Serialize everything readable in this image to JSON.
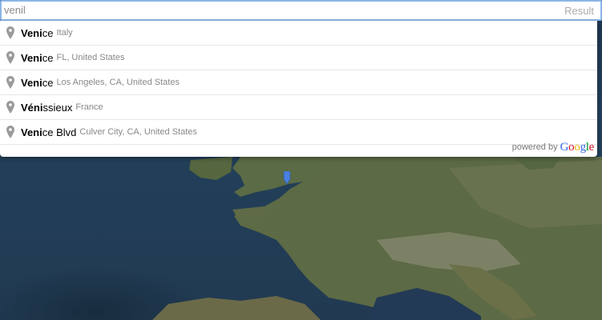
{
  "search": {
    "value": "venil",
    "result_label": "Result"
  },
  "suggestions": [
    {
      "match": "Veni",
      "rest": "ce",
      "secondary": "Italy",
      "icon": "map-pin-icon"
    },
    {
      "match": "Veni",
      "rest": "ce",
      "secondary": "FL, United States",
      "icon": "map-pin-icon"
    },
    {
      "match": "Veni",
      "rest": "ce",
      "secondary": "Los Angeles, CA, United States",
      "icon": "map-pin-icon"
    },
    {
      "match": "Véni",
      "rest": "ssieux",
      "secondary": "France",
      "icon": "map-pin-icon"
    },
    {
      "match": "Veni",
      "rest": "ce Blvd",
      "secondary": "Culver City, CA, United States",
      "icon": "map-pin-icon"
    }
  ],
  "footer": {
    "powered_by": "powered by",
    "logo_letters": [
      "G",
      "o",
      "o",
      "g",
      "l",
      "e"
    ],
    "logo_colors": [
      "#3369e8",
      "#d50f25",
      "#eeb211",
      "#3369e8",
      "#009925",
      "#d50f25"
    ]
  },
  "map": {
    "marker_color": "#4a7fe0",
    "icon": "map-marker-icon"
  }
}
